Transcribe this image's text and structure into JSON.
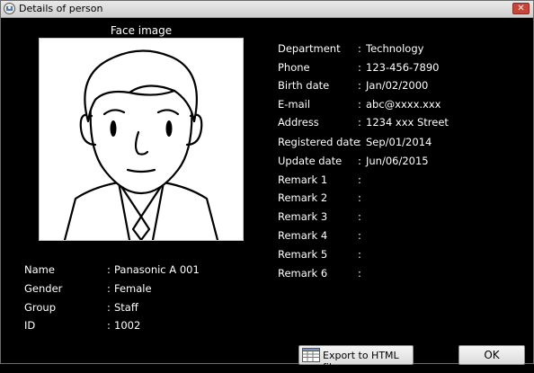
{
  "window": {
    "title": "Details of person"
  },
  "face": {
    "caption": "Face image"
  },
  "person": [
    {
      "label": "Name",
      "value": "Panasonic A 001"
    },
    {
      "label": "Gender",
      "value": "Female"
    },
    {
      "label": "Group",
      "value": "Staff"
    },
    {
      "label": "ID",
      "value": "1002"
    }
  ],
  "details": [
    {
      "label": "Department",
      "value": "Technology"
    },
    {
      "label": "Phone",
      "value": "123-456-7890"
    },
    {
      "label": "Birth date",
      "value": "Jan/02/2000"
    },
    {
      "label": "E-mail",
      "value": "abc@xxxx.xxx"
    },
    {
      "label": "Address",
      "value": "1234 xxx Street"
    },
    {
      "label": "Registered date",
      "value": "Sep/01/2014"
    },
    {
      "label": "Update date",
      "value": "Jun/06/2015"
    },
    {
      "label": "Remark 1",
      "value": ""
    },
    {
      "label": "Remark 2",
      "value": ""
    },
    {
      "label": "Remark 3",
      "value": ""
    },
    {
      "label": "Remark 4",
      "value": ""
    },
    {
      "label": "Remark 5",
      "value": ""
    },
    {
      "label": "Remark 6",
      "value": ""
    }
  ],
  "separator": ":",
  "buttons": {
    "export_label": "Export to HTML file",
    "ok_label": "OK"
  }
}
